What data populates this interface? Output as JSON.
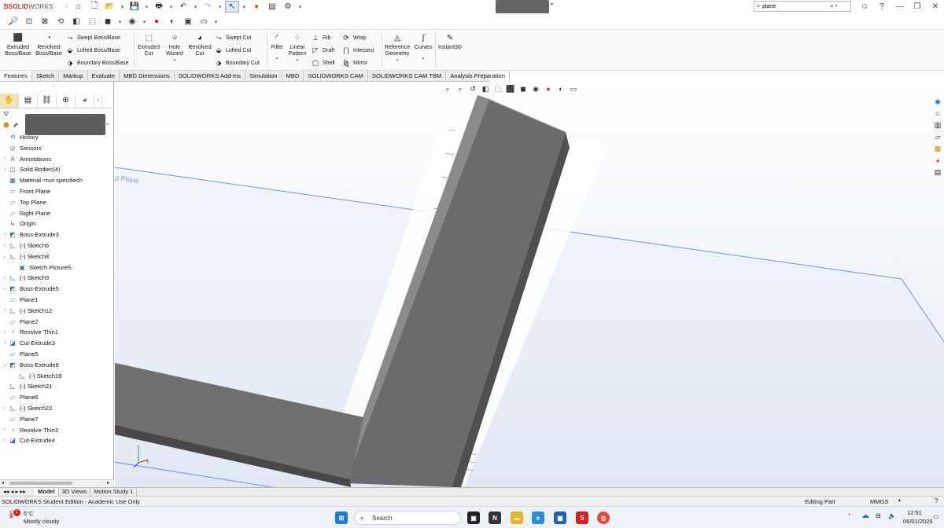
{
  "app": {
    "logo_brand": "SOLID",
    "logo_rest": "WORKS",
    "search_value": "plane",
    "search_prefix": ">"
  },
  "command_manager": {
    "large": [
      {
        "id": "extruded-boss-base-button",
        "label": "Extruded\nBoss/Base"
      },
      {
        "id": "revolved-boss-base-button",
        "label": "Revolved\nBoss/Base"
      },
      {
        "id": "extruded-cut-button",
        "label": "Extruded\nCut"
      },
      {
        "id": "hole-wizard-button",
        "label": "Hole\nWizard"
      },
      {
        "id": "revolved-cut-button",
        "label": "Revolved\nCut"
      },
      {
        "id": "fillet-button",
        "label": "Fillet"
      },
      {
        "id": "linear-pattern-button",
        "label": "Linear\nPattern"
      },
      {
        "id": "reference-geometry-button",
        "label": "Reference\nGeometry"
      },
      {
        "id": "curves-button",
        "label": "Curves"
      },
      {
        "id": "instant3d-button",
        "label": "Instant3D"
      }
    ],
    "small": {
      "swept_boss": "Swept Boss/Base",
      "lofted_boss": "Lofted Boss/Base",
      "boundary_boss": "Boundary Boss/Base",
      "swept_cut": "Swept Cut",
      "lofted_cut": "Lofted Cut",
      "boundary_cut": "Boundary Cut",
      "rib": "Rib",
      "draft": "Draft",
      "shell": "Shell",
      "wrap": "Wrap",
      "intersect": "Intersect",
      "mirror": "Mirror"
    }
  },
  "tabs": [
    "Features",
    "Sketch",
    "Markup",
    "Evaluate",
    "MBD Dimensions",
    "SOLIDWORKS Add-Ins",
    "Simulation",
    "MBD",
    "SOLIDWORKS CAM",
    "SOLIDWORKS CAM TBM",
    "Analysis Preparation"
  ],
  "active_tab": "Features",
  "tree": [
    {
      "label": "History",
      "icon": "history-icon",
      "expand": false,
      "indent": 0
    },
    {
      "label": "Sensors",
      "icon": "sensors-icon",
      "expand": false,
      "indent": 0
    },
    {
      "label": "Annotations",
      "icon": "annotations-icon",
      "expand": true,
      "indent": 0
    },
    {
      "label": "Solid Bodies(4)",
      "icon": "solid-bodies-icon",
      "expand": true,
      "indent": 0
    },
    {
      "label": "Material <not specified>",
      "icon": "material-icon",
      "expand": false,
      "indent": 0
    },
    {
      "label": "Front Plane",
      "icon": "plane-icon",
      "expand": false,
      "indent": 0
    },
    {
      "label": "Top Plane",
      "icon": "plane-icon",
      "expand": false,
      "indent": 0
    },
    {
      "label": "Right Plane",
      "icon": "plane-icon",
      "expand": false,
      "indent": 0
    },
    {
      "label": "Origin",
      "icon": "origin-icon",
      "expand": false,
      "indent": 0
    },
    {
      "label": "Boss-Extrude3",
      "icon": "extrude-icon",
      "expand": true,
      "indent": 0
    },
    {
      "label": "(-) Sketch6",
      "icon": "sketch-icon",
      "expand": true,
      "indent": 0
    },
    {
      "label": "(-) Sketch8",
      "icon": "sketch-icon",
      "expand": "open",
      "indent": 0
    },
    {
      "label": "Sketch Picture5",
      "icon": "picture-icon",
      "expand": false,
      "indent": 1
    },
    {
      "label": "(-) Sketch9",
      "icon": "sketch-icon",
      "expand": true,
      "indent": 0
    },
    {
      "label": "Boss-Extrude5",
      "icon": "extrude-icon",
      "expand": true,
      "indent": 0
    },
    {
      "label": "Plane1",
      "icon": "plane-icon",
      "expand": false,
      "indent": 0
    },
    {
      "label": "(-) Sketch12",
      "icon": "sketch-icon",
      "expand": true,
      "indent": 0
    },
    {
      "label": "Plane2",
      "icon": "plane-icon",
      "expand": false,
      "indent": 0
    },
    {
      "label": "Revolve-Thin1",
      "icon": "revolve-icon",
      "expand": true,
      "indent": 0
    },
    {
      "label": "Cut-Extrude3",
      "icon": "cut-extrude-icon",
      "expand": true,
      "indent": 0
    },
    {
      "label": "Plane5",
      "icon": "plane-icon",
      "expand": false,
      "indent": 0
    },
    {
      "label": "Boss-Extrude6",
      "icon": "extrude-icon",
      "expand": "open",
      "indent": 0
    },
    {
      "label": "(-) Sketch19",
      "icon": "sketch-icon",
      "expand": false,
      "indent": 1
    },
    {
      "label": "(-) Sketch21",
      "icon": "sketch-icon",
      "expand": false,
      "indent": 0
    },
    {
      "label": "Plane6",
      "icon": "plane-icon",
      "expand": false,
      "indent": 0
    },
    {
      "label": "(-) Sketch22",
      "icon": "sketch-icon",
      "expand": true,
      "indent": 0
    },
    {
      "label": "Plane7",
      "icon": "plane-icon",
      "expand": false,
      "indent": 0
    },
    {
      "label": "Revolve-Thin3",
      "icon": "revolve-icon",
      "expand": true,
      "indent": 0
    },
    {
      "label": "Cut-Extrude4",
      "icon": "cut-extrude-icon",
      "expand": true,
      "indent": 0
    }
  ],
  "viewport": {
    "plane_label": "p Plane"
  },
  "model_tabs": [
    "Model",
    "3D Views",
    "Motion Study 1"
  ],
  "status": {
    "left": "SOLIDWORKS Student Edition - Academic Use Only",
    "mode": "Editing Part",
    "units": "MMGS"
  },
  "taskbar": {
    "weather_temp": "5°C",
    "weather_desc": "Mostly cloudy",
    "weather_badge": "1",
    "search": "Search",
    "time": "12:51",
    "date": "06/01/2026"
  }
}
